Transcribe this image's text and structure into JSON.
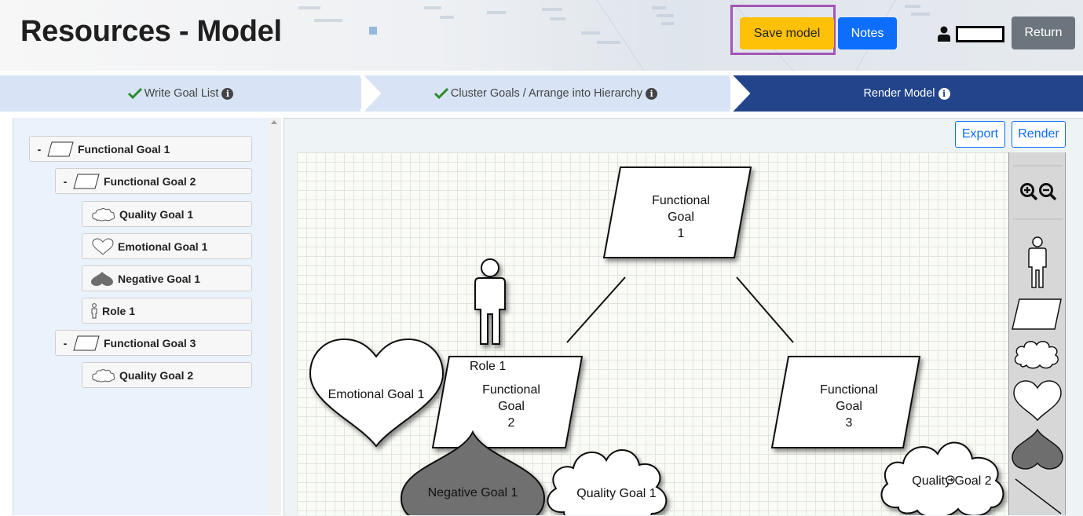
{
  "header": {
    "title": "Resources - Model",
    "save_label": "Save model",
    "notes_label": "Notes",
    "return_label": "Return",
    "user_icon": "user-icon"
  },
  "steps": [
    {
      "label": "Write Goal List",
      "done": true,
      "active": false
    },
    {
      "label": "Cluster Goals / Arrange into Hierarchy",
      "done": true,
      "active": false
    },
    {
      "label": "Render Model",
      "done": false,
      "active": true
    }
  ],
  "tree": [
    {
      "label": "Functional Goal 1",
      "type": "functional",
      "collapse": "-"
    },
    {
      "label": "Functional Goal 2",
      "type": "functional",
      "collapse": "-"
    },
    {
      "label": "Quality Goal 1",
      "type": "quality"
    },
    {
      "label": "Emotional Goal 1",
      "type": "emotional"
    },
    {
      "label": "Negative Goal 1",
      "type": "negative"
    },
    {
      "label": "Role 1",
      "type": "role"
    },
    {
      "label": "Functional Goal 3",
      "type": "functional",
      "collapse": "-"
    },
    {
      "label": "Quality Goal 2",
      "type": "quality"
    }
  ],
  "canvas": {
    "export_label": "Export",
    "render_label": "Render",
    "nodes": {
      "fg1": [
        "Functional",
        "Goal",
        "1"
      ],
      "fg2": [
        "Functional",
        "Goal",
        "2"
      ],
      "fg3": [
        "Functional",
        "Goal",
        "3"
      ],
      "role": "Role 1",
      "emotional": "Emotional Goal 1",
      "negative": "Negative Goal 1",
      "quality1": "Quality Goal 1",
      "quality2": "Quality Goal 2"
    }
  },
  "palette": {
    "tools": [
      "zoom-in-icon",
      "zoom-out-icon",
      "role-shape",
      "functional-goal-shape",
      "quality-goal-shape",
      "emotional-goal-shape",
      "negative-goal-shape",
      "connector-line"
    ]
  },
  "colors": {
    "save": "#ffc107",
    "notes": "#0d6efd",
    "return": "#6c757d",
    "step_active": "#21448a",
    "step_inactive": "#d8e4f6",
    "check": "#2e8b2e",
    "negative_fill": "#707070",
    "highlight": "#a455b5"
  }
}
